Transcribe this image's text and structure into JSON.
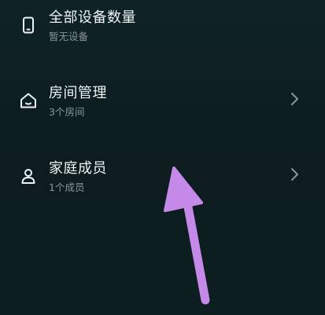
{
  "items": [
    {
      "title": "全部设备数量",
      "subtitle": "暂无设备",
      "icon": "phone-icon",
      "has_chevron": false
    },
    {
      "title": "房间管理",
      "subtitle": "3个房间",
      "icon": "home-icon",
      "has_chevron": true
    },
    {
      "title": "家庭成员",
      "subtitle": "1个成员",
      "icon": "person-icon",
      "has_chevron": true
    }
  ],
  "annotation": {
    "icon": "pointer-arrow-icon",
    "color": "#c58ae8"
  },
  "colors": {
    "background": "#0d1f22",
    "title": "#eef3f3",
    "subtitle": "#8a9698",
    "chevron": "#8a9698"
  }
}
